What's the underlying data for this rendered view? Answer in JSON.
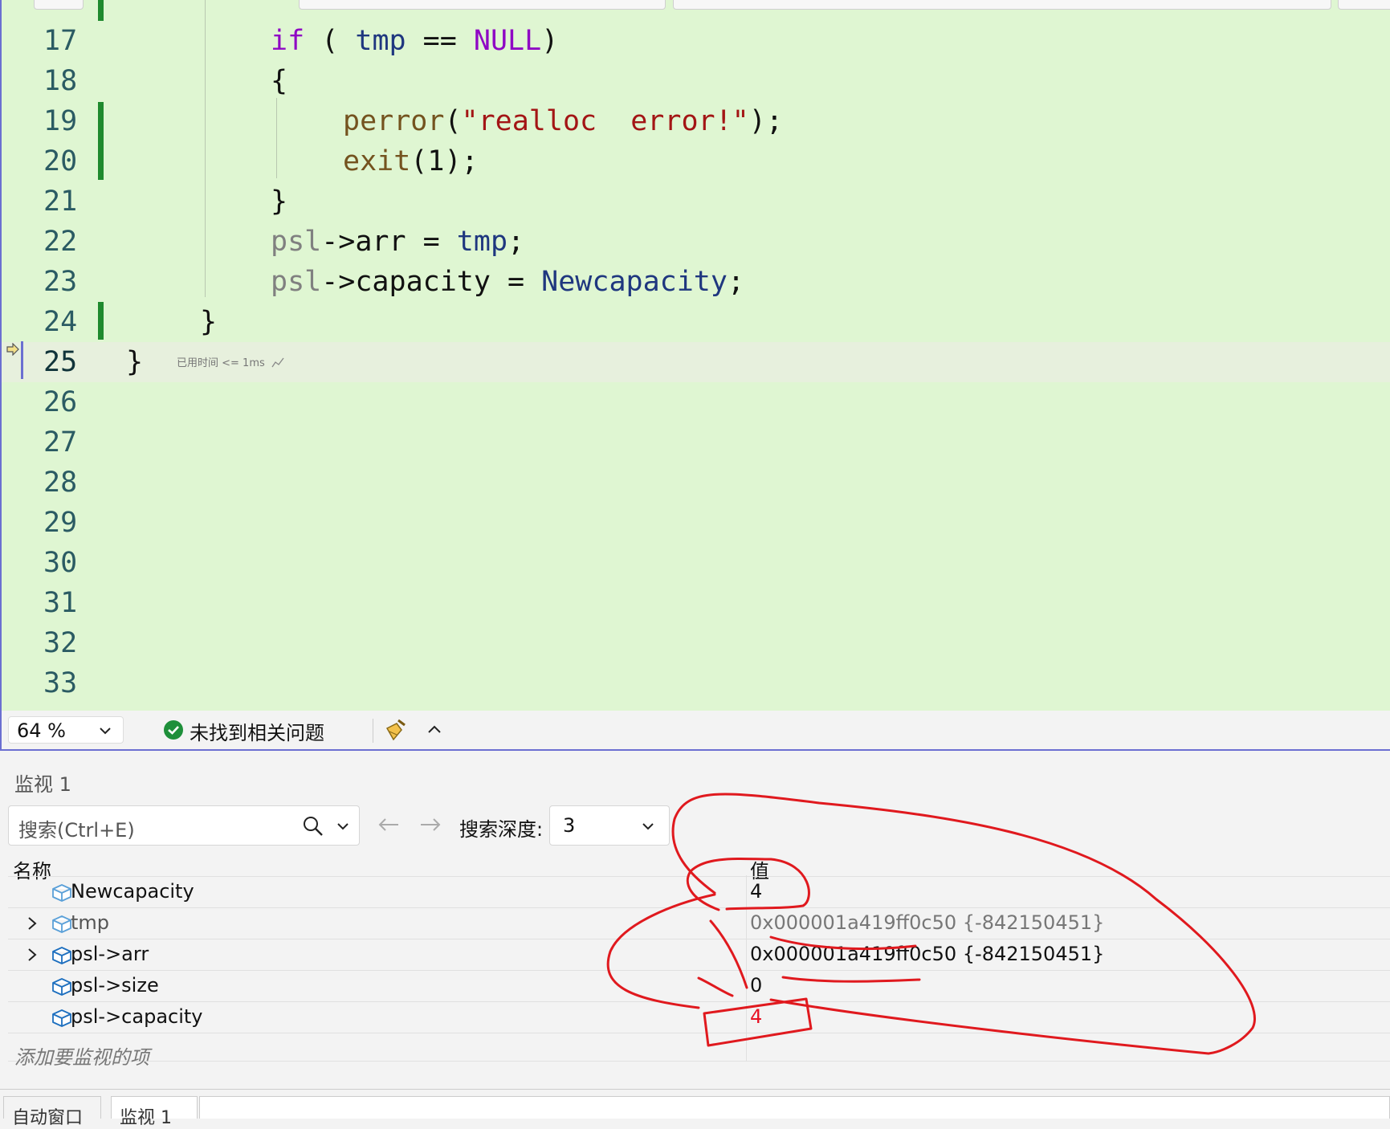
{
  "editor": {
    "lines": [
      {
        "num": "17",
        "tokens": [
          {
            "t": "if",
            "c": "kw"
          },
          {
            "t": " ( ",
            "c": "pl"
          },
          {
            "t": "tmp",
            "c": "var"
          },
          {
            "t": " == ",
            "c": "pl"
          },
          {
            "t": "NULL",
            "c": "kw"
          },
          {
            "t": ")",
            "c": "pl"
          }
        ]
      },
      {
        "num": "18",
        "tokens": [
          {
            "t": "{",
            "c": "pl"
          }
        ]
      },
      {
        "num": "19",
        "tokens": [
          {
            "t": "perror",
            "c": "fn"
          },
          {
            "t": "(",
            "c": "pl"
          },
          {
            "t": "\"realloc  error!\"",
            "c": "str"
          },
          {
            "t": ");",
            "c": "pl"
          }
        ]
      },
      {
        "num": "20",
        "tokens": [
          {
            "t": "exit",
            "c": "fn"
          },
          {
            "t": "(1);",
            "c": "pl"
          }
        ]
      },
      {
        "num": "21",
        "tokens": [
          {
            "t": "}",
            "c": "pl"
          }
        ]
      },
      {
        "num": "22",
        "tokens": [
          {
            "t": "psl",
            "c": "gray"
          },
          {
            "t": "->arr = ",
            "c": "pl"
          },
          {
            "t": "tmp",
            "c": "var"
          },
          {
            "t": ";",
            "c": "pl"
          }
        ]
      },
      {
        "num": "23",
        "tokens": [
          {
            "t": "psl",
            "c": "gray"
          },
          {
            "t": "->capacity = ",
            "c": "pl"
          },
          {
            "t": "Newcapacity",
            "c": "var"
          },
          {
            "t": ";",
            "c": "pl"
          }
        ]
      },
      {
        "num": "24",
        "tokens": [
          {
            "t": "}",
            "c": "pl"
          }
        ]
      },
      {
        "num": "25",
        "tokens": [
          {
            "t": "}",
            "c": "pl"
          }
        ]
      },
      {
        "num": "26",
        "tokens": []
      },
      {
        "num": "27",
        "tokens": []
      },
      {
        "num": "28",
        "tokens": []
      },
      {
        "num": "29",
        "tokens": []
      },
      {
        "num": "30",
        "tokens": []
      },
      {
        "num": "31",
        "tokens": []
      },
      {
        "num": "32",
        "tokens": []
      },
      {
        "num": "33",
        "tokens": []
      }
    ],
    "perf_tip": "已用时间 <= 1ms"
  },
  "status": {
    "zoom": "64 %",
    "issues": "未找到相关问题"
  },
  "watch": {
    "title": "监视 1",
    "search_placeholder": "搜索(Ctrl+E)",
    "depth_label": "搜索深度:",
    "depth_value": "3",
    "col_name": "名称",
    "col_value": "值",
    "rows": [
      {
        "name": "Newcapacity",
        "value": "4"
      },
      {
        "name": "tmp",
        "value": "0x000001a419ff0c50 {-842150451}"
      },
      {
        "name": "psl->arr",
        "value": "0x000001a419ff0c50 {-842150451}"
      },
      {
        "name": "psl->size",
        "value": "0"
      },
      {
        "name": "psl->capacity",
        "value": "4"
      }
    ],
    "add_item": "添加要监视的项"
  },
  "bottom_tabs": [
    "自动窗口",
    "监视 1"
  ],
  "colors": {
    "editor_bg": "#dff6d2",
    "keyword": "#8f08c4",
    "string": "#a31515",
    "function": "#74531f",
    "variable": "#1f377f",
    "change_bar": "#1f8a2e",
    "changed_value": "#e81123",
    "annotation": "#e0191e"
  }
}
